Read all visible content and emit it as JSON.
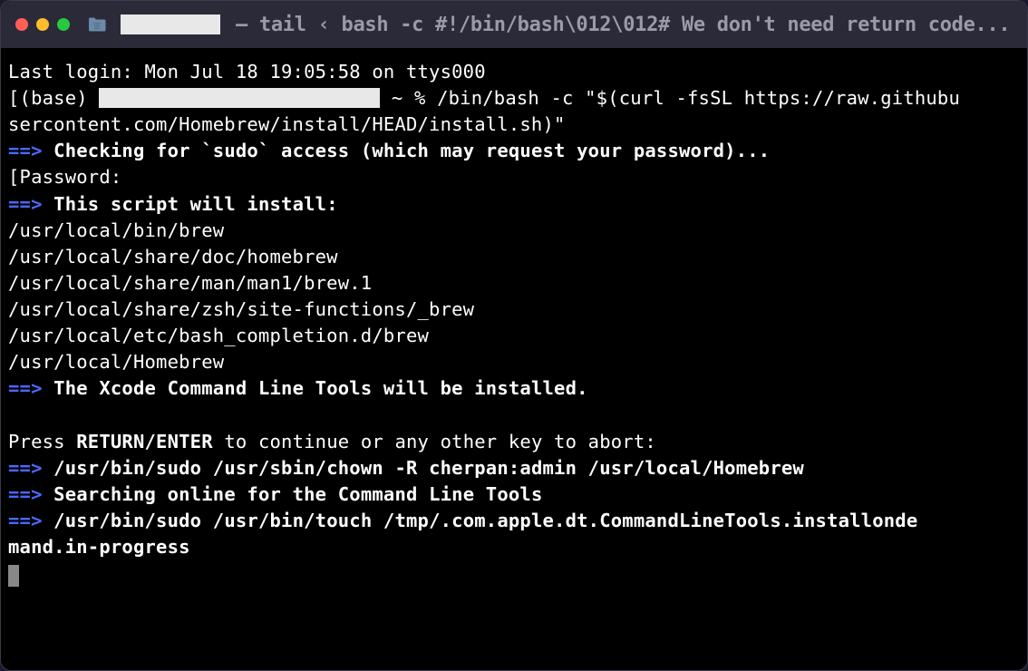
{
  "titlebar": {
    "title": "— tail ‹ bash -c #!/bin/bash\\012\\012# We don't need return code..."
  },
  "terminal": {
    "last_login": "Last login: Mon Jul 18 19:05:58 on ttys000",
    "prompt_prefix": "[(base) ",
    "prompt_suffix": " ~ % ",
    "install_cmd_part1": "/bin/bash -c \"$(curl -fsSL https://raw.githubu",
    "install_cmd_part2": "sercontent.com/Homebrew/install/HEAD/install.sh)\"",
    "arrow": "==>",
    "sudo_check": " Checking for `sudo` access (which may request your password)...",
    "password_prompt": "[Password:",
    "install_header": " This script will install:",
    "paths": {
      "p1": "/usr/local/bin/brew",
      "p2": "/usr/local/share/doc/homebrew",
      "p3": "/usr/local/share/man/man1/brew.1",
      "p4": "/usr/local/share/zsh/site-functions/_brew",
      "p5": "/usr/local/etc/bash_completion.d/brew",
      "p6": "/usr/local/Homebrew"
    },
    "xcode_msg": " The Xcode Command Line Tools will be installed.",
    "press_prefix": "Press ",
    "press_bold": "RETURN/ENTER",
    "press_suffix": " to continue or any other key to abort:",
    "chown_cmd": " /usr/bin/sudo /usr/sbin/chown -R cherpan:admin /usr/local/Homebrew",
    "search_msg": " Searching online for the Command Line Tools",
    "touch_cmd_part1": " /usr/bin/sudo /usr/bin/touch /tmp/.com.apple.dt.CommandLineTools.installonde",
    "touch_cmd_part2": "mand.in-progress"
  }
}
